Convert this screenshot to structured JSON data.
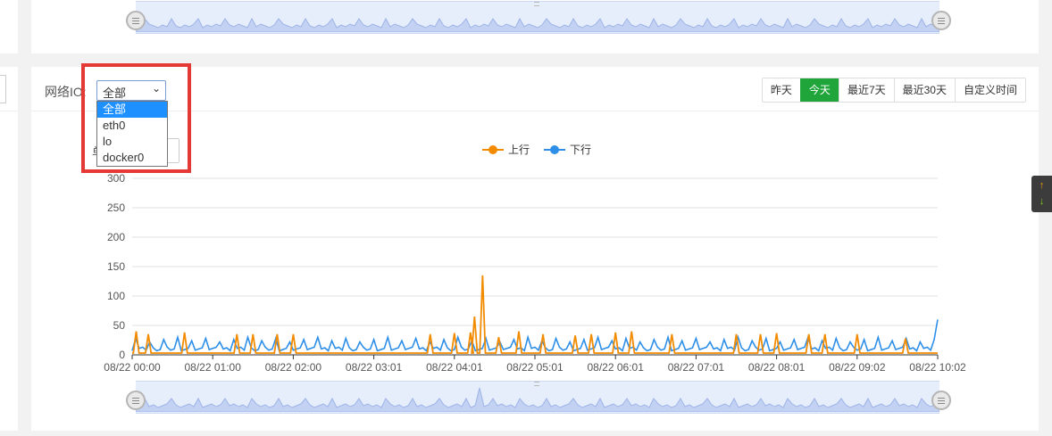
{
  "network_io": {
    "label": "网络IO:",
    "selected": "全部",
    "options": [
      "全部",
      "eth0",
      "lo",
      "docker0"
    ]
  },
  "unit_label": "单",
  "time_buttons": [
    {
      "label": "昨天",
      "active": false
    },
    {
      "label": "今天",
      "active": true
    },
    {
      "label": "最近7天",
      "active": false
    },
    {
      "label": "最近30天",
      "active": false
    },
    {
      "label": "自定义时间",
      "active": false
    }
  ],
  "floating_tool": {
    "up": "↑",
    "down": "↓"
  },
  "colors": {
    "upload": "#f28b00",
    "download": "#2e8fe8",
    "active_button": "#20a53a",
    "highlight": "#e53935"
  },
  "chart_data": {
    "type": "line",
    "legend": [
      "上行",
      "下行"
    ],
    "legend_position": "top-center",
    "grid": true,
    "ylim": [
      0,
      300
    ],
    "yticks": [
      "0",
      "50",
      "100",
      "150",
      "200",
      "250",
      "300"
    ],
    "xticks": [
      "08/22 00:00",
      "08/22 01:00",
      "08/22 02:00",
      "08/22 03:01",
      "08/22 04:01",
      "08/22 05:01",
      "08/22 06:01",
      "08/22 07:01",
      "08/22 08:01",
      "08/22 09:02",
      "08/22 10:02"
    ],
    "series": [
      {
        "name": "上行",
        "color": "#f28b00",
        "baseline": 3,
        "spikes": [
          {
            "x": 0.05,
            "y": 40
          },
          {
            "x": 0.2,
            "y": 35
          },
          {
            "x": 0.65,
            "y": 38
          },
          {
            "x": 1.3,
            "y": 35
          },
          {
            "x": 1.5,
            "y": 35
          },
          {
            "x": 1.8,
            "y": 35
          },
          {
            "x": 2.0,
            "y": 35
          },
          {
            "x": 3.7,
            "y": 35
          },
          {
            "x": 4.0,
            "y": 37
          },
          {
            "x": 4.2,
            "y": 38
          },
          {
            "x": 4.25,
            "y": 65
          },
          {
            "x": 4.35,
            "y": 135
          },
          {
            "x": 4.55,
            "y": 30
          },
          {
            "x": 4.8,
            "y": 40
          },
          {
            "x": 5.1,
            "y": 35
          },
          {
            "x": 5.5,
            "y": 33
          },
          {
            "x": 5.7,
            "y": 35
          },
          {
            "x": 6.0,
            "y": 38
          },
          {
            "x": 6.2,
            "y": 40
          },
          {
            "x": 6.7,
            "y": 35
          },
          {
            "x": 7.5,
            "y": 35
          },
          {
            "x": 7.8,
            "y": 35
          },
          {
            "x": 8.0,
            "y": 37
          },
          {
            "x": 8.4,
            "y": 35
          },
          {
            "x": 8.6,
            "y": 35
          },
          {
            "x": 9.0,
            "y": 35
          },
          {
            "x": 9.6,
            "y": 28
          }
        ]
      },
      {
        "name": "下行",
        "color": "#2e8fe8",
        "baseline": 10,
        "end_value": 60,
        "spike_height": 20
      }
    ]
  }
}
